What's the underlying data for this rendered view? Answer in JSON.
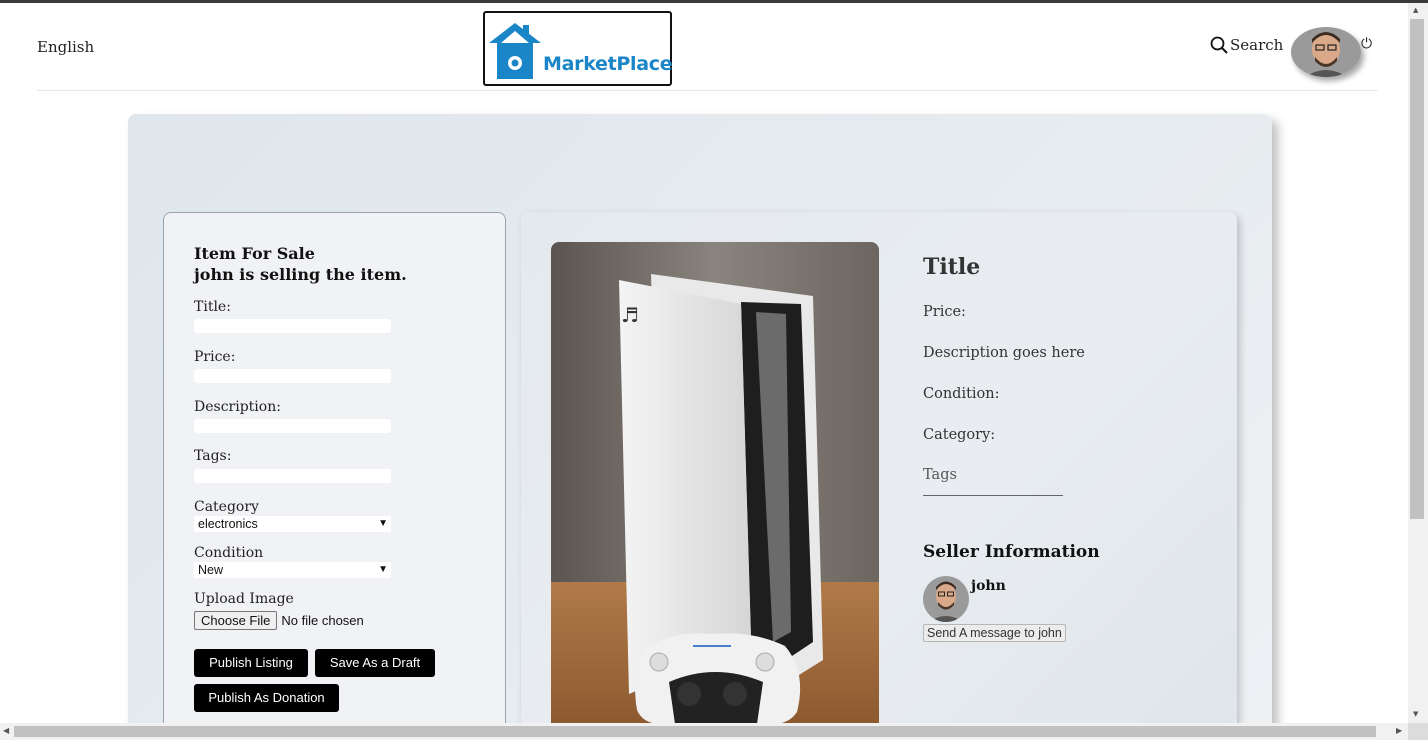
{
  "header": {
    "language": "English",
    "logo_text": "MarketPlace",
    "search_label": "Search",
    "power_icon": "⏻"
  },
  "form": {
    "heading_line1": "Item For Sale",
    "heading_line2": "john is selling the item.",
    "title_label": "Title:",
    "price_label": "Price:",
    "description_label": "Description:",
    "tags_label": "Tags:",
    "category_label": "Category",
    "category_value": "electronics",
    "condition_label": "Condition",
    "condition_value": "New",
    "upload_label": "Upload Image",
    "choose_file": "Choose File",
    "file_status": "No file chosen",
    "publish_button": "Publish Listing",
    "draft_button": "Save As a Draft",
    "donation_button": "Publish As Donation"
  },
  "preview": {
    "title": "Title",
    "price": "Price:",
    "description": "Description goes here",
    "condition": "Condition:",
    "category": "Category:",
    "tags": "Tags"
  },
  "seller": {
    "heading": "Seller Information",
    "name": "john",
    "message_button": "Send A message to john"
  },
  "colors": {
    "brand_blue": "#1a86c7",
    "button_black": "#000000",
    "panel_bg": "#e4e9ee"
  },
  "icons": {
    "search": "search-icon",
    "power": "power-icon",
    "logo": "house-logo-icon"
  }
}
